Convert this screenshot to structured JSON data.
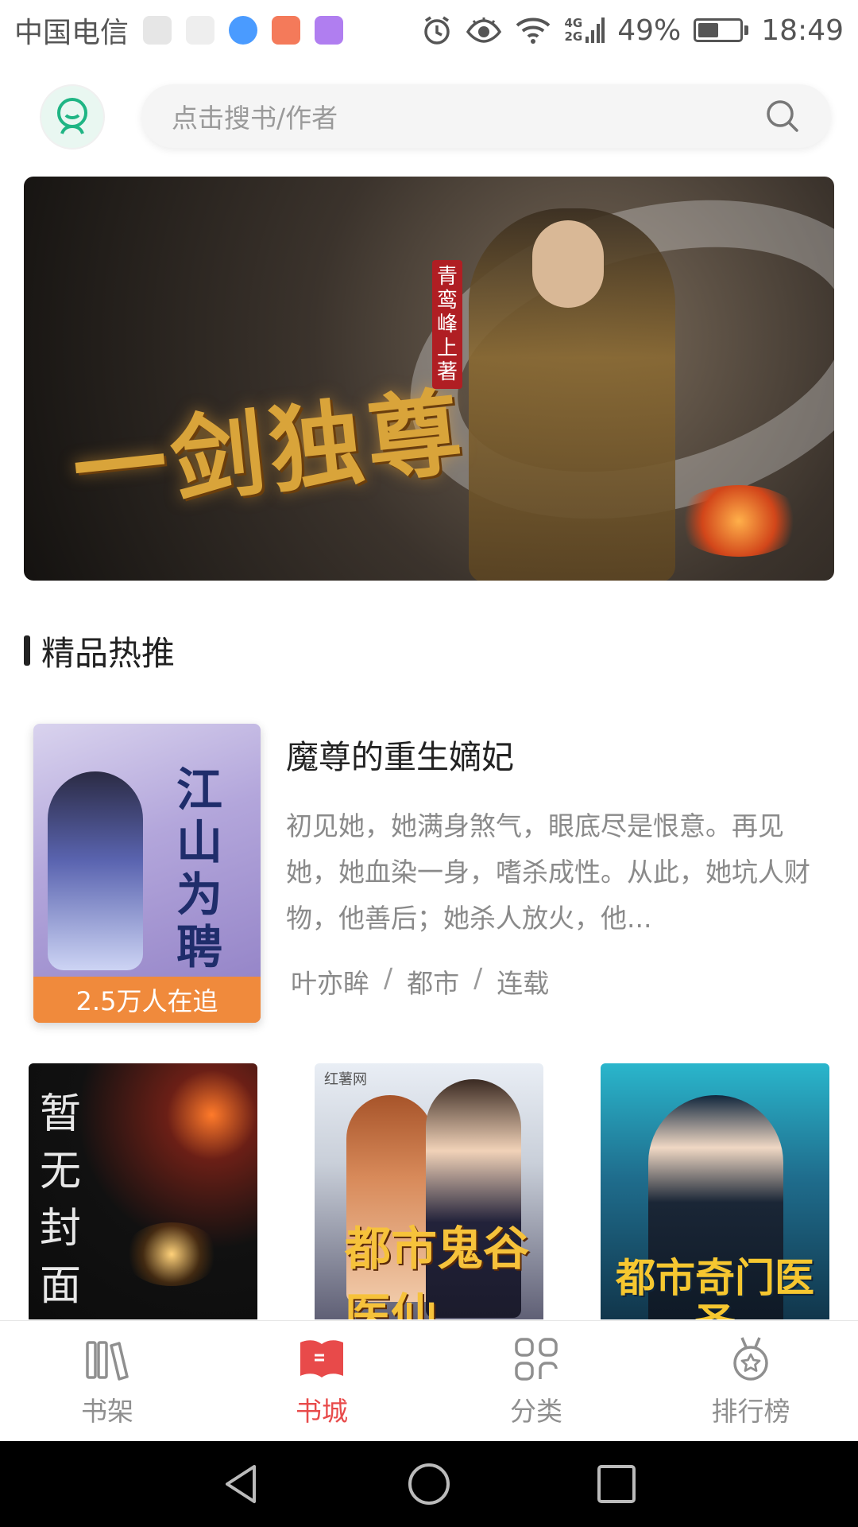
{
  "status_bar": {
    "carrier": "中国电信",
    "network_4g": "4G",
    "network_2g": "2G",
    "battery": "49%",
    "battery_level": 0.49,
    "time": "18:49"
  },
  "header": {
    "search_placeholder": "点击搜书/作者"
  },
  "banner": {
    "title": "一剑独尊",
    "author_seal": "青鸾峰上著"
  },
  "section": {
    "title": "精品热推"
  },
  "featured_book": {
    "title": "魔尊的重生嫡妃",
    "cover_title": "江山为聘",
    "followers": "2.5万人在追",
    "description": "初见她，她满身煞气，眼底尽是恨意。再见她，她血染一身，嗜杀成性。从此，她坑人财物，他善后；她杀人放火，他...",
    "author": "叶亦眸",
    "category": "都市",
    "status": "连载",
    "separator": "/"
  },
  "grid_books": [
    {
      "cover_text": "暂无封面"
    },
    {
      "cover_text": "都市鬼谷医仙",
      "brand": "红薯网"
    },
    {
      "cover_text": "都市奇门医圣"
    }
  ],
  "bottom_nav": [
    {
      "label": "书架",
      "icon": "bookshelf-icon",
      "active": false
    },
    {
      "label": "书城",
      "icon": "book-open-icon",
      "active": true
    },
    {
      "label": "分类",
      "icon": "grid-icon",
      "active": false
    },
    {
      "label": "排行榜",
      "icon": "medal-icon",
      "active": false
    }
  ],
  "colors": {
    "accent": "#e84a4a",
    "badge": "#f08a3c",
    "avatar": "#1fb584"
  }
}
